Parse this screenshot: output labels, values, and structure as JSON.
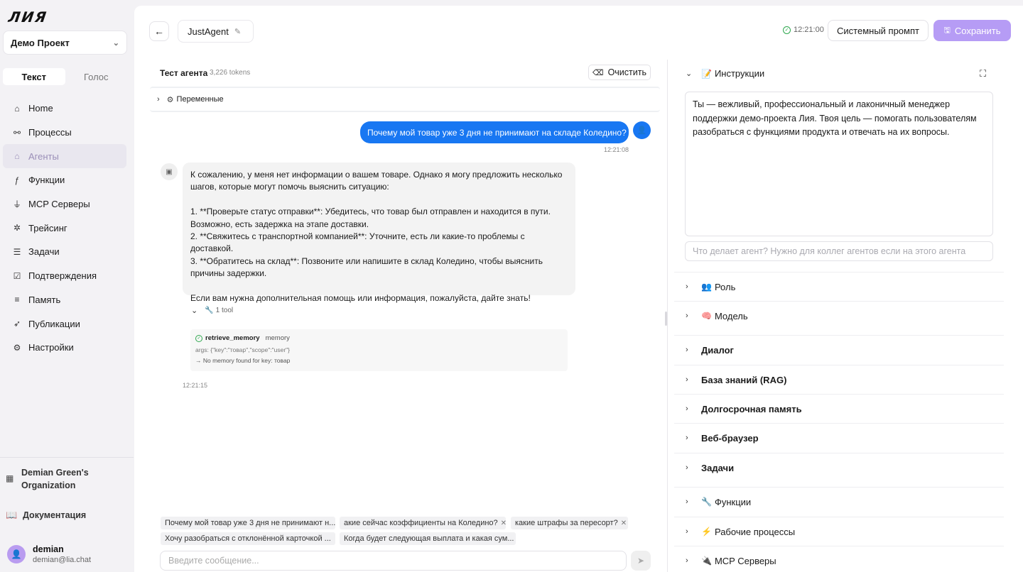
{
  "sidebar": {
    "logo": "ЛИЯ",
    "project": "Демо Проект",
    "modes": [
      "Текст",
      "Голос"
    ],
    "items": [
      {
        "label": "Home",
        "icon": "home-icon"
      },
      {
        "label": "Процессы",
        "icon": "workflow-icon"
      },
      {
        "label": "Агенты",
        "icon": "agent-icon"
      },
      {
        "label": "Функции",
        "icon": "function-icon"
      },
      {
        "label": "MCP Серверы",
        "icon": "plug-icon"
      },
      {
        "label": "Трейсинг",
        "icon": "tracing-icon"
      },
      {
        "label": "Задачи",
        "icon": "tasks-icon"
      },
      {
        "label": "Подтверждения",
        "icon": "approval-icon"
      },
      {
        "label": "Память",
        "icon": "database-icon"
      },
      {
        "label": "Публикации",
        "icon": "rocket-icon"
      },
      {
        "label": "Настройки",
        "icon": "gear-icon"
      }
    ],
    "org": "Demian Green's Organization",
    "docs": "Документация",
    "user": {
      "name": "demian",
      "email": "demian@lia.chat"
    }
  },
  "header": {
    "agent_name": "JustAgent",
    "saved_time": "12:21:00",
    "system_prompt_label": "Системный промпт",
    "save_label": "Сохранить"
  },
  "chat": {
    "title": "Тест агента",
    "tokens": "3,226 tokens",
    "clear_label": "Очистить",
    "variables_label": "Переменные",
    "user_message": "Почему мой товар уже 3 дня не принимают на складе Коледино?",
    "user_time": "12:21:08",
    "bot_lines": [
      "К сожалению, у меня нет информации о вашем товаре. Однако я могу предложить несколько шагов, которые могут помочь выяснить ситуацию:",
      "",
      "1. **Проверьте статус отправки**: Убедитесь, что товар был отправлен и находится в пути. Возможно, есть задержка на этапе доставки.",
      "2. **Свяжитесь с транспортной компанией**: Уточните, есть ли какие-то проблемы с доставкой.",
      "3. **Обратитесь на склад**: Позвоните или напишите в склад Коледино, чтобы выяснить причины задержки.",
      "",
      "Если вам нужна дополнительная помощь или информация, пожалуйста, дайте знать!"
    ],
    "tool_count": "1 tool",
    "tool": {
      "name": "retrieve_memory",
      "tag": "memory",
      "args": "args: {\"key\":\"товар\",\"scope\":\"user\"}",
      "result": "→ No memory found for key: товар"
    },
    "bot_time": "12:21:15",
    "suggestions": [
      "Почему мой товар уже 3 дня не принимают н...",
      "акие сейчас коэффициенты на Коледино?",
      "какие штрафы за пересорт?",
      "Хочу разобраться с отклонённой карточкой ...",
      "Когда будет следующая выплата и какая сум..."
    ],
    "input_placeholder": "Введите сообщение..."
  },
  "config": {
    "instructions_label": "Инструкции",
    "instructions_text": "Ты — вежливый, профессиональный и лаконичный менеджер поддержки демо-проекта Лия. Твоя цель — помогать пользователям разобраться с функциями продукта и отвечать на их вопросы.",
    "description_placeholder": "Что делает агент? Нужно для коллег агентов если на этого агента",
    "sections": [
      {
        "label": "Роль",
        "emoji": "👥"
      },
      {
        "label": "Модель",
        "emoji": "🧠"
      },
      {
        "label": "Диалог",
        "emoji": ""
      },
      {
        "label": "База знаний (RAG)",
        "emoji": ""
      },
      {
        "label": "Долгосрочная память",
        "emoji": ""
      },
      {
        "label": "Веб-браузер",
        "emoji": ""
      },
      {
        "label": "Задачи",
        "emoji": ""
      },
      {
        "label": "Функции",
        "emoji": "🔧"
      },
      {
        "label": "Рабочие процессы",
        "emoji": "⚡"
      },
      {
        "label": "MCP Серверы",
        "emoji": "🔌"
      }
    ]
  },
  "colors": {
    "accent": "#b69cf5",
    "user_bubble": "#1877f2",
    "success": "#2fa84f"
  }
}
